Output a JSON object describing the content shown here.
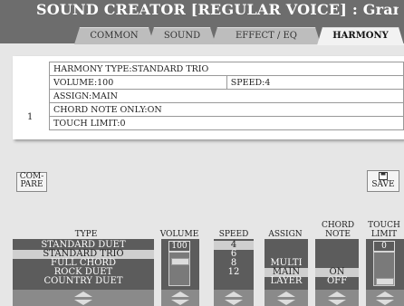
{
  "title": "SOUND CREATOR [REGULAR VOICE] : GrandPiano",
  "tabs": [
    "COMMON",
    "SOUND",
    "EFFECT / EQ",
    "HARMONY"
  ],
  "active_tab": "HARMONY",
  "info": {
    "row_number": "1",
    "harmony_type": "HARMONY TYPE:STANDARD TRIO",
    "volume": "VOLUME:100",
    "speed": "SPEED:4",
    "assign": "ASSIGN:MAIN",
    "chord_note_only": "CHORD NOTE ONLY:ON",
    "touch_limit": "TOUCH LIMIT:0"
  },
  "buttons": {
    "compare": "COM-\nPARE",
    "save": "SAVE",
    "save_icon": "floppy-disk-icon"
  },
  "headers": {
    "type": "TYPE",
    "volume": "VOLUME",
    "speed": "SPEED",
    "assign": "ASSIGN",
    "chord_note_only_1": "CHORD",
    "chord_note_only_2": "NOTE ONLY",
    "touch_limit_1": "TOUCH",
    "touch_limit_2": "LIMIT"
  },
  "type_list": [
    "STANDARD DUET",
    "STANDARD TRIO",
    "FULL CHORD",
    "ROCK DUET",
    "COUNTRY DUET"
  ],
  "type_selected": "STANDARD TRIO",
  "volume_value": "100",
  "speed_list": [
    "4",
    "6",
    "8",
    "12"
  ],
  "speed_selected": "4",
  "assign_list": [
    "MULTI",
    "MAIN",
    "LAYER"
  ],
  "assign_selected": "MAIN",
  "chord_note_only_list": [
    "ON",
    "OFF"
  ],
  "chord_note_only_selected": "ON",
  "touch_limit_value": "0",
  "levels": {
    "volume": 100,
    "volume_max": 127,
    "touch_limit": 0
  },
  "colors": {
    "header_bg": "#6d6d6d",
    "panel_bg": "#5c5c5c",
    "selected_bg": "#cfcfcf",
    "screen_bg": "#e6e6e6"
  }
}
